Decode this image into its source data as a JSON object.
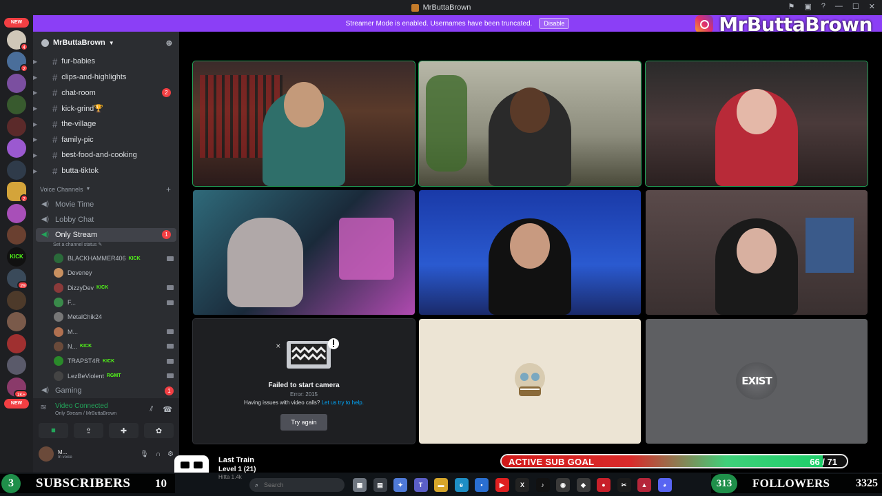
{
  "window": {
    "title": "MrButtaBrown",
    "controls": [
      "⚑",
      "▣",
      "?",
      "—",
      "☐",
      "✕"
    ]
  },
  "banner": {
    "text": "Streamer Mode is enabled. Usernames have been truncated.",
    "button": "Disable"
  },
  "brand": {
    "name": "MrButtaBrown",
    "icon": "instagram-icon"
  },
  "servers": {
    "new_top": "NEW",
    "new_bottom": "NEW",
    "badges": [
      "4",
      "2",
      "",
      "",
      "",
      "",
      "",
      "2",
      "",
      "",
      "",
      "29",
      "",
      "",
      "",
      "",
      "1K+"
    ]
  },
  "guild": {
    "name": "MrButtaBrown"
  },
  "text_channels": [
    {
      "name": "fur-babies",
      "count": ""
    },
    {
      "name": "clips-and-highlights",
      "count": ""
    },
    {
      "name": "chat-room",
      "count": "2"
    },
    {
      "name": "kick-grind🏆",
      "count": ""
    },
    {
      "name": "the-village",
      "count": ""
    },
    {
      "name": "family-pic",
      "count": ""
    },
    {
      "name": "best-food-and-cooking",
      "count": ""
    },
    {
      "name": "butta-tiktok",
      "count": ""
    }
  ],
  "voice_category": {
    "label": "Voice Channels"
  },
  "voice_channels": {
    "movie": "Movie Time",
    "lobby": "Lobby Chat",
    "only_stream": "Only Stream",
    "only_stream_count": "1",
    "status_placeholder": "Set a channel status",
    "gaming": "Gaming",
    "gaming_count": "1"
  },
  "members": [
    {
      "name": "BLACKHAMMER406",
      "tag": "KICK",
      "cam": true
    },
    {
      "name": "Deveney",
      "tag": "",
      "cam": false
    },
    {
      "name": "DizzyDev",
      "tag": "KICK",
      "cam": true
    },
    {
      "name": "F...",
      "tag": "",
      "cam": true
    },
    {
      "name": "MetalChik24",
      "tag": "",
      "cam": false
    },
    {
      "name": "M...",
      "tag": "",
      "cam": true
    },
    {
      "name": "N...",
      "tag": "KICK",
      "cam": true
    },
    {
      "name": "TRAPST4R",
      "tag": "KICK",
      "cam": true
    },
    {
      "name": "LezBeViolent",
      "tag": "RGMT",
      "cam": true
    }
  ],
  "voice_panel": {
    "status": "Video Connected",
    "location": "Only Stream / MrButtaBrown"
  },
  "user": {
    "name": "M...",
    "status": "In voice"
  },
  "camera_error": {
    "title": "Failed to start camera",
    "code": "Error: 2015",
    "help_text": "Having issues with video calls?",
    "help_link": "Let us try to help.",
    "button": "Try again"
  },
  "exist_tile": {
    "logo": "EXIST"
  },
  "train": {
    "title": "Last Train",
    "level": "Level 1 (21)",
    "faded": "Hitta 1.4k"
  },
  "sub_goal": {
    "label": "ACTIVE SUB GOAL",
    "current": 66,
    "target": 71,
    "progress_text": "66 / 71"
  },
  "subs_bar": {
    "left": "3",
    "word": "SUBSCRIBERS",
    "right": "10"
  },
  "followers_bar": {
    "left": "313",
    "word": "FOLLOWERS",
    "right": "3325"
  },
  "taskbar": {
    "search_placeholder": "Search",
    "apps": [
      {
        "icon": "gallery-icon",
        "color": "#6f7680",
        "glyph": "▦"
      },
      {
        "icon": "task-view-icon",
        "color": "#3a3f46",
        "glyph": "▤"
      },
      {
        "icon": "copilot-icon",
        "color": "#4f7ad8",
        "glyph": "✦"
      },
      {
        "icon": "teams-icon",
        "color": "#5b5fc7",
        "glyph": "T"
      },
      {
        "icon": "file-explorer-icon",
        "color": "#d6a62a",
        "glyph": "▬"
      },
      {
        "icon": "edge-icon",
        "color": "#1e8ec5",
        "glyph": "e"
      },
      {
        "icon": "store-icon",
        "color": "#2a6fd1",
        "glyph": "▪"
      },
      {
        "icon": "youtube-icon",
        "color": "#e02020",
        "glyph": "▶"
      },
      {
        "icon": "x-icon",
        "color": "#222222",
        "glyph": "X"
      },
      {
        "icon": "tiktok-icon",
        "color": "#111111",
        "glyph": "♪"
      },
      {
        "icon": "obs-icon",
        "color": "#3a3a3a",
        "glyph": "◉"
      },
      {
        "icon": "streamlabs-icon",
        "color": "#3b3b3b",
        "glyph": "◆"
      },
      {
        "icon": "record-icon",
        "color": "#c8202a",
        "glyph": "●"
      },
      {
        "icon": "capcut-icon",
        "color": "#1b1b1b",
        "glyph": "✂"
      },
      {
        "icon": "app-red-icon",
        "color": "#b5263a",
        "glyph": "▲"
      },
      {
        "icon": "discord-icon",
        "color": "#5865f2",
        "glyph": "◕"
      }
    ]
  },
  "colors": {
    "accent_purple": "#8b3ff6",
    "discord_bg": "#2b2d31",
    "speaking_green": "#23a55a",
    "kick_green": "#53fc18",
    "goal_red": "#d11a1a",
    "goal_green": "#1ecf6a"
  }
}
